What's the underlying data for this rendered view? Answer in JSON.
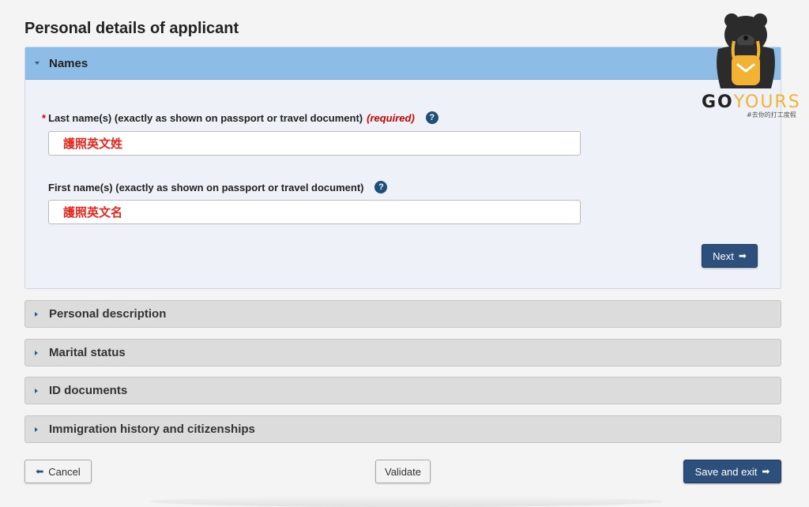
{
  "page_title": "Personal details of applicant",
  "names_panel": {
    "title": "Names",
    "last_name": {
      "star": "*",
      "label": "Last name(s) (exactly as shown on passport or travel document)",
      "required": "(required)",
      "help": "?",
      "value": "護照英文姓"
    },
    "first_name": {
      "label": "First name(s) (exactly as shown on passport or travel document)",
      "help": "?",
      "value": "護照英文名"
    },
    "next_label": "Next",
    "next_arrow": "➡"
  },
  "sections": [
    "Personal description",
    "Marital status",
    "ID documents",
    "Immigration history and citizenships"
  ],
  "footer": {
    "cancel_label": "Cancel",
    "cancel_arrow": "⬅",
    "validate_label": "Validate",
    "save_label": "Save and exit",
    "save_arrow": "➡"
  },
  "logo": {
    "go": "GO",
    "yours": "YOURS",
    "tagline": "#去你的打工度假"
  },
  "colors": {
    "primary_button": "#2c4f7c",
    "panel_header_active": "#8dbde6",
    "required": "#cc0000",
    "input_text": "#e8251c",
    "logo_yellow": "#f2b233"
  }
}
